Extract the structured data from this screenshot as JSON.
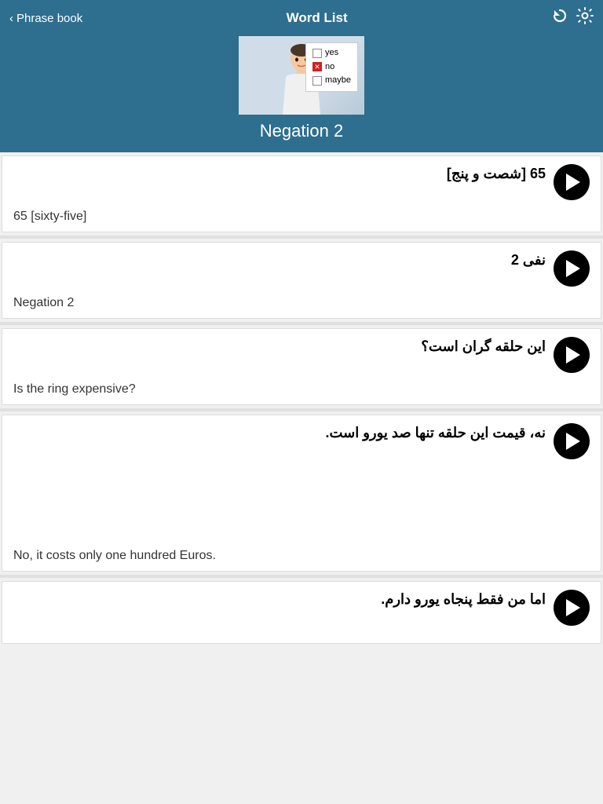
{
  "header": {
    "back_label": "Phrase book",
    "title": "Word List",
    "refresh_icon": "↻",
    "settings_icon": "⚙"
  },
  "hero": {
    "title": "Negation 2",
    "image_alt": "Person thinking with checkboxes",
    "checkboxes": [
      {
        "label": "yes",
        "checked": false
      },
      {
        "label": "no",
        "checked": true
      },
      {
        "label": "maybe",
        "checked": false
      }
    ]
  },
  "cards": [
    {
      "id": "card-65",
      "arabic": "65 [شصت و پنج]",
      "english": "65 [sixty-five]"
    },
    {
      "id": "card-negation2",
      "arabic": "نفی 2",
      "english": "Negation 2"
    },
    {
      "id": "card-ring-question",
      "arabic": "این حلقه گران است؟",
      "english": "Is the ring expensive?"
    },
    {
      "id": "card-ring-answer",
      "arabic": "نه، قیمت این حلقه تنها صد یورو است.",
      "english": "No, it costs only one hundred Euros."
    },
    {
      "id": "card-fifty",
      "arabic": "اما من فقط پنجاه یورو دارم.",
      "english": ""
    }
  ]
}
